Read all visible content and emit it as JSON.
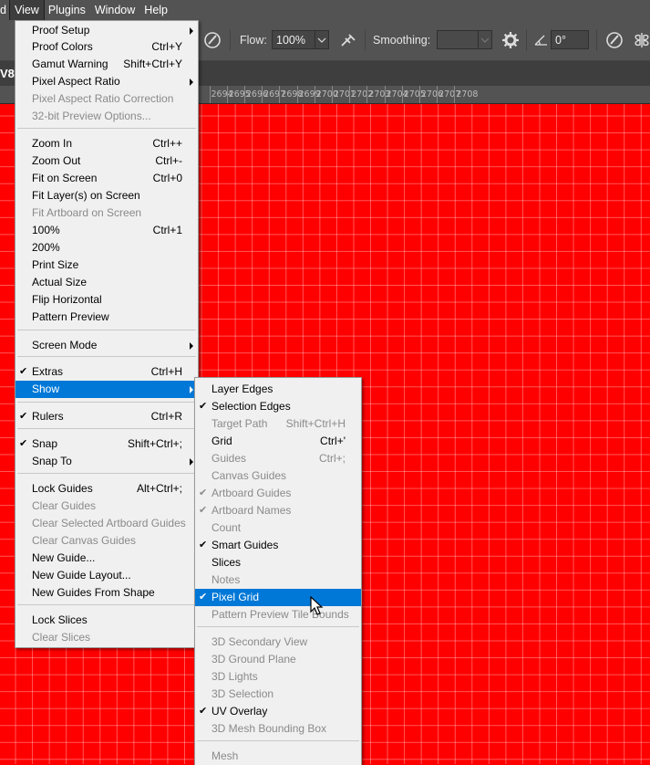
{
  "menubar": {
    "items": [
      {
        "label": "d"
      },
      {
        "label": "View"
      },
      {
        "label": "Plugins"
      },
      {
        "label": "Window"
      },
      {
        "label": "Help"
      }
    ]
  },
  "options": {
    "flow_label": "Flow:",
    "flow_value": "100%",
    "smoothing_label": "Smoothing:",
    "smoothing_value": "",
    "angle_value": "0°"
  },
  "doc_tab": {
    "partial_title": "V8"
  },
  "ruler": {
    "labels": [
      "2694",
      "2695",
      "2696",
      "2697",
      "2698",
      "2699",
      "2700",
      "2701",
      "2702",
      "2703",
      "2704",
      "2705",
      "2706",
      "2707",
      "2708"
    ]
  },
  "view_menu": {
    "items": [
      {
        "label": "Proof Setup",
        "shortcut": "",
        "submenu": true
      },
      {
        "label": "Proof Colors",
        "shortcut": "Ctrl+Y"
      },
      {
        "label": "Gamut Warning",
        "shortcut": "Shift+Ctrl+Y"
      },
      {
        "label": "Pixel Aspect Ratio",
        "shortcut": "",
        "submenu": true
      },
      {
        "label": "Pixel Aspect Ratio Correction",
        "shortcut": "",
        "disabled": true
      },
      {
        "label": "32-bit Preview Options...",
        "shortcut": "",
        "disabled": true
      },
      {
        "label": "Zoom In",
        "shortcut": "Ctrl++"
      },
      {
        "label": "Zoom Out",
        "shortcut": "Ctrl+-"
      },
      {
        "label": "Fit on Screen",
        "shortcut": "Ctrl+0"
      },
      {
        "label": "Fit Layer(s) on Screen",
        "shortcut": ""
      },
      {
        "label": "Fit Artboard on Screen",
        "shortcut": "",
        "disabled": true
      },
      {
        "label": "100%",
        "shortcut": "Ctrl+1"
      },
      {
        "label": "200%",
        "shortcut": ""
      },
      {
        "label": "Print Size",
        "shortcut": ""
      },
      {
        "label": "Actual Size",
        "shortcut": ""
      },
      {
        "label": "Flip Horizontal",
        "shortcut": ""
      },
      {
        "label": "Pattern Preview",
        "shortcut": ""
      },
      {
        "label": "Screen Mode",
        "shortcut": "",
        "submenu": true
      },
      {
        "label": "Extras",
        "shortcut": "Ctrl+H",
        "checked": true
      },
      {
        "label": "Show",
        "shortcut": "",
        "submenu": true,
        "highlighted": true
      },
      {
        "label": "Rulers",
        "shortcut": "Ctrl+R",
        "checked": true
      },
      {
        "label": "Snap",
        "shortcut": "Shift+Ctrl+;",
        "checked": true
      },
      {
        "label": "Snap To",
        "shortcut": "",
        "submenu": true
      },
      {
        "label": "Lock Guides",
        "shortcut": "Alt+Ctrl+;"
      },
      {
        "label": "Clear Guides",
        "shortcut": "",
        "disabled": true
      },
      {
        "label": "Clear Selected Artboard Guides",
        "shortcut": "",
        "disabled": true
      },
      {
        "label": "Clear Canvas Guides",
        "shortcut": "",
        "disabled": true
      },
      {
        "label": "New Guide...",
        "shortcut": ""
      },
      {
        "label": "New Guide Layout...",
        "shortcut": ""
      },
      {
        "label": "New Guides From Shape",
        "shortcut": ""
      },
      {
        "label": "Lock Slices",
        "shortcut": ""
      },
      {
        "label": "Clear Slices",
        "shortcut": "",
        "disabled": true
      }
    ]
  },
  "show_menu": {
    "items": [
      {
        "label": "Layer Edges",
        "shortcut": ""
      },
      {
        "label": "Selection Edges",
        "shortcut": "",
        "checked": true
      },
      {
        "label": "Target Path",
        "shortcut": "Shift+Ctrl+H",
        "disabled": true
      },
      {
        "label": "Grid",
        "shortcut": "Ctrl+'"
      },
      {
        "label": "Guides",
        "shortcut": "Ctrl+;",
        "disabled": true
      },
      {
        "label": "Canvas Guides",
        "shortcut": "",
        "disabled": true
      },
      {
        "label": "Artboard Guides",
        "shortcut": "",
        "disabled": true,
        "checked": true
      },
      {
        "label": "Artboard Names",
        "shortcut": "",
        "disabled": true,
        "checked": true
      },
      {
        "label": "Count",
        "shortcut": "",
        "disabled": true
      },
      {
        "label": "Smart Guides",
        "shortcut": "",
        "checked": true
      },
      {
        "label": "Slices",
        "shortcut": ""
      },
      {
        "label": "Notes",
        "shortcut": "",
        "disabled": true
      },
      {
        "label": "Pixel Grid",
        "shortcut": "",
        "checked": true,
        "highlighted": true
      },
      {
        "label": "Pattern Preview Tile Bounds",
        "shortcut": "",
        "disabled": true
      },
      {
        "label": "3D Secondary View",
        "shortcut": "",
        "disabled": true
      },
      {
        "label": "3D Ground Plane",
        "shortcut": "",
        "disabled": true
      },
      {
        "label": "3D Lights",
        "shortcut": "",
        "disabled": true
      },
      {
        "label": "3D Selection",
        "shortcut": "",
        "disabled": true
      },
      {
        "label": "UV Overlay",
        "shortcut": "",
        "checked": true
      },
      {
        "label": "3D Mesh Bounding Box",
        "shortcut": "",
        "disabled": true
      },
      {
        "label": "Mesh",
        "shortcut": "",
        "disabled": true
      }
    ]
  },
  "colors": {
    "highlight": "#0078d7",
    "canvas": "#ff0000",
    "menu_bg": "#f0f0f0",
    "chrome": "#535353"
  }
}
